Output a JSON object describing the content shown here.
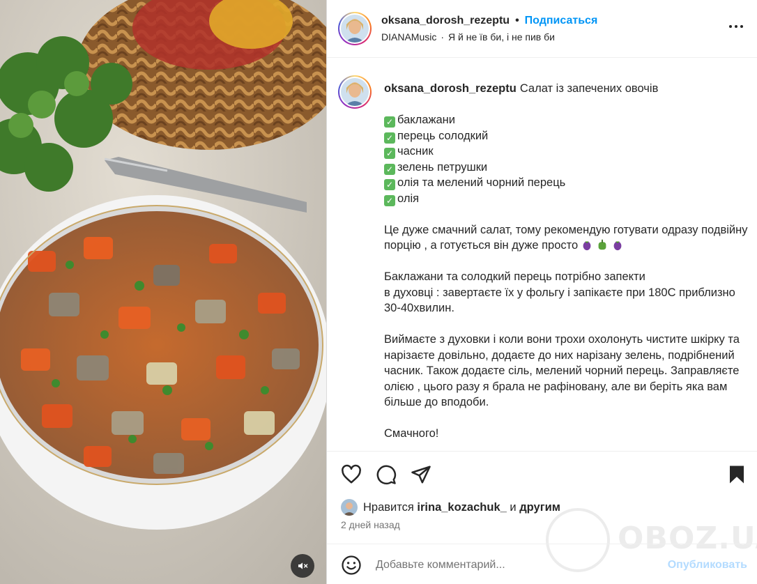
{
  "header": {
    "username": "oksana_dorosh_rezeptu",
    "separator": "•",
    "follow_label": "Подписаться",
    "music_artist": "DIANAMusic",
    "music_separator": "·",
    "music_title": "Я й не їв би, і не пив би"
  },
  "caption": {
    "username": "oksana_dorosh_rezeptu",
    "title": "Салат із запечених овочів",
    "ingredients": [
      "баклажани",
      "перець солодкий",
      "часник",
      "зелень петрушки",
      "олія та мелений чорний перець",
      "олія"
    ],
    "paragraph_1": "Це дуже смачний салат, тому рекомендую готувати одразу подвійну порцію , а готується він дуже просто",
    "paragraph_2_line_1": "Баклажани та солодкий перець потрібно запекти",
    "paragraph_2_line_2": "в духовці : завертаєте їх у фольгу і запікаєте при 180С приблизно 30-40хвилин.",
    "paragraph_3": "Виймаєте з духовки і коли вони трохи охолонуть чистите шкірку та нарізаєте довільно, додаєте до них нарізану зелень, подрібнений часник. Також додаєте сіль, мелений чорний перець. Заправляєте олією , цього разу я брала не рафіновану, але ви беріть яка вам більше до вподоби.",
    "closing": "Смачного!"
  },
  "likes": {
    "prefix": "Нравится",
    "user": "irina_kozachuk_",
    "conjunction": "и",
    "others": "другим"
  },
  "date": "2 дней назад",
  "comment": {
    "placeholder": "Добавьте комментарий...",
    "publish_label": "Опубликовать"
  },
  "watermark": {
    "text": "OBOZ.UA"
  },
  "icons": {
    "like": "heart-icon",
    "comment": "comment-icon",
    "share": "send-icon",
    "save": "bookmark-icon",
    "more": "more-options-icon",
    "emoji": "emoji-icon",
    "mute": "muted-speaker-icon"
  },
  "colors": {
    "accent": "#0095f6",
    "publish_disabled": "#b3dbff",
    "text": "#262626",
    "secondary_text": "#737373"
  }
}
